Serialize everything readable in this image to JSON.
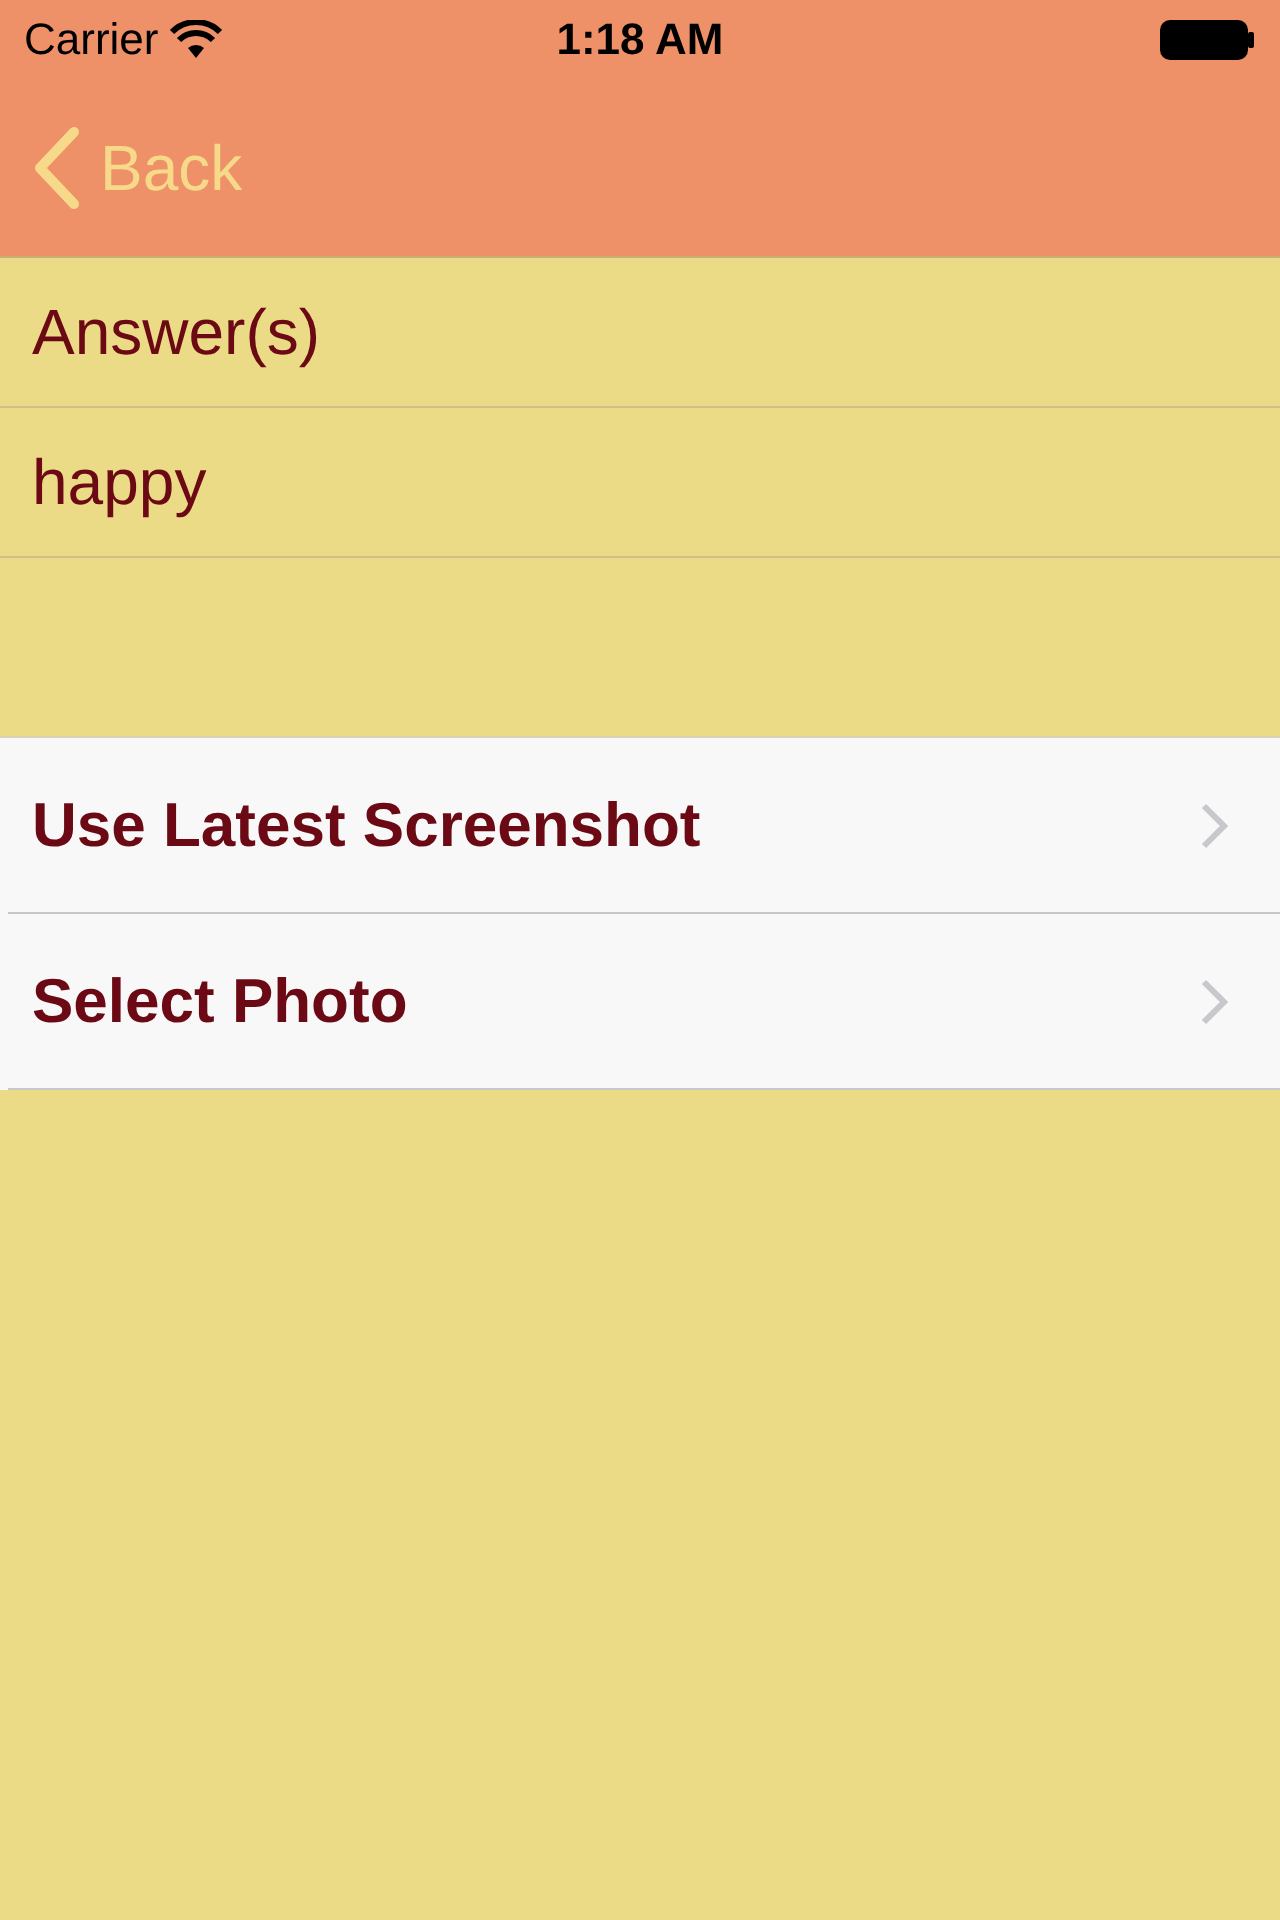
{
  "status_bar": {
    "carrier": "Carrier",
    "time": "1:18 AM"
  },
  "nav_bar": {
    "back_label": "Back"
  },
  "answer_rows": [
    {
      "text": "Answer(s)"
    },
    {
      "text": "happy"
    }
  ],
  "actions": [
    {
      "label": "Use Latest Screenshot"
    },
    {
      "label": "Select Photo"
    }
  ]
}
